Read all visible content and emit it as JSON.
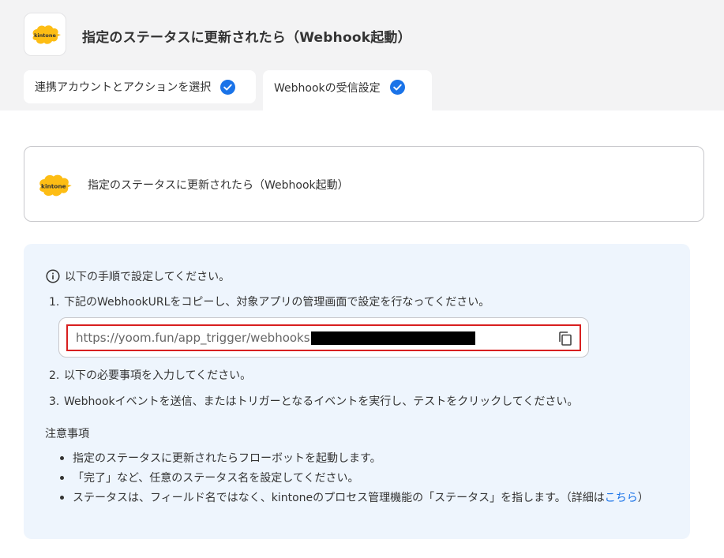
{
  "header": {
    "app_icon": "kintone-logo",
    "app_logo_text": "kintone",
    "title": "指定のステータスに更新されたら（Webhook起動）"
  },
  "tabs": [
    {
      "label": "連携アカウントとアクションを選択",
      "status_icon": "check-circle-icon",
      "active": false
    },
    {
      "label": "Webhookの受信設定",
      "status_icon": "check-circle-icon",
      "active": true
    }
  ],
  "trigger_card": {
    "app_icon": "kintone-logo",
    "title": "指定のステータスに更新されたら（Webhook起動）"
  },
  "instructions": {
    "intro_icon": "info-icon",
    "intro": "以下の手順で設定してください。",
    "steps": [
      {
        "num": "1.",
        "text": "下記のWebhookURLをコピーし、対象アプリの管理画面で設定を行なってください。"
      },
      {
        "num": "2.",
        "text": "以下の必要事項を入力してください。"
      },
      {
        "num": "3.",
        "text": "Webhookイベントを送信、またはトリガーとなるイベントを実行し、テストをクリックしてください。"
      }
    ],
    "webhook_url": "https://yoom.fun/app_trigger/webhooks",
    "copy_icon": "copy-icon",
    "notes_title": "注意事項",
    "notes": [
      "指定のステータスに更新されたらフローボットを起動します。",
      "「完了」など、任意のステータス名を設定してください。",
      "ステータスは、フィールド名ではなく、kintoneのプロセス管理機能の「ステータス」を指します。（詳細は"
    ],
    "notes_link": "こちら",
    "notes_suffix": "）"
  },
  "colors": {
    "accent": "#1a73e8",
    "check": "#1a73e8",
    "highlight_border": "#d81f1f",
    "panel_bg": "#eef5fd",
    "kintone_yellow": "#fdbd14"
  }
}
